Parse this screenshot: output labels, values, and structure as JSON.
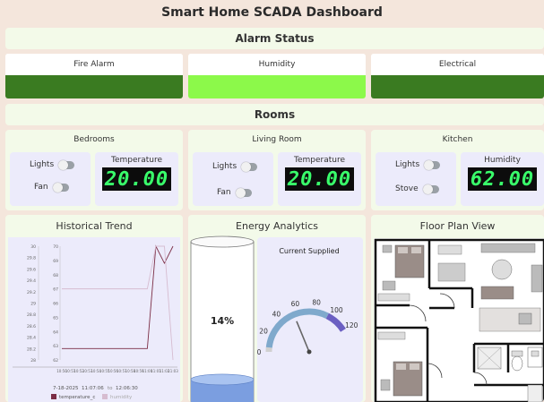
{
  "app_title": "Smart Home SCADA Dashboard",
  "alarm_section": {
    "title": "Alarm Status",
    "alarms": [
      {
        "label": "Fire Alarm",
        "color": "#3a7b21"
      },
      {
        "label": "Humidity",
        "color": "#8cf94a"
      },
      {
        "label": "Electrical",
        "color": "#3a7b21"
      }
    ]
  },
  "rooms_section": {
    "title": "Rooms",
    "rooms": [
      {
        "name": "Bedrooms",
        "toggles": [
          "Lights",
          "Fan"
        ],
        "sensor_label": "Temperature",
        "sensor_value": "20.00"
      },
      {
        "name": "Living Room",
        "toggles": [
          "Lights",
          "Fan"
        ],
        "sensor_label": "Temperature",
        "sensor_value": "20.00"
      },
      {
        "name": "Kitchen",
        "toggles": [
          "Lights",
          "Stove"
        ],
        "sensor_label": "Humidity",
        "sensor_value": "62.00"
      }
    ]
  },
  "historical": {
    "title": "Historical Trend",
    "left_axis_ticks": [
      "30",
      "29.8",
      "29.6",
      "29.4",
      "29.2",
      "29",
      "28.8",
      "28.6",
      "28.4",
      "28.2",
      "28"
    ],
    "right_axis_ticks": [
      "70",
      "69",
      "68",
      "67",
      "66",
      "65",
      "64",
      "63",
      "62"
    ],
    "x_ticks": [
      "10:50",
      "10:51",
      "10:52",
      "10:53",
      "10:54",
      "10:55",
      "10:56",
      "10:57",
      "10:58",
      "10:59",
      "11:00",
      "11:01",
      "11:02",
      "11:03"
    ],
    "date": "7-18-2025",
    "time_from": "11:07:06",
    "to_label": "to",
    "time_to": "12:06:30",
    "legend": [
      {
        "name": "temperature_c",
        "color": "#7b2d45"
      },
      {
        "name": "humidity",
        "color": "#d6bcd0"
      }
    ]
  },
  "chart_data": {
    "type": "line",
    "x": [
      "10:50",
      "10:51",
      "10:52",
      "10:53",
      "10:54",
      "10:55",
      "10:56",
      "10:57",
      "10:58",
      "10:59",
      "11:00",
      "11:01",
      "11:02",
      "11:03"
    ],
    "ylim_left": [
      28,
      30
    ],
    "ylim_right": [
      62,
      70
    ],
    "series": [
      {
        "name": "temperature_c",
        "axis": "left",
        "values": [
          28.2,
          28.2,
          28.2,
          28.2,
          28.2,
          28.2,
          28.2,
          28.2,
          28.2,
          28.2,
          28.2,
          30,
          29.7,
          30
        ]
      },
      {
        "name": "humidity",
        "axis": "right",
        "values": [
          67,
          67,
          67,
          67,
          67,
          67,
          67,
          67,
          67,
          67,
          67,
          70,
          70,
          62
        ]
      }
    ]
  },
  "energy": {
    "title": "Energy Analytics",
    "tank_percent": 14,
    "tank_label": "14%",
    "gauge_title": "Current Supplied",
    "gauge_ticks": [
      "0",
      "20",
      "40",
      "60",
      "80",
      "100",
      "120"
    ],
    "gauge_value": 55,
    "gauge_max": 120
  },
  "floorplan": {
    "title": "Floor Plan View"
  }
}
